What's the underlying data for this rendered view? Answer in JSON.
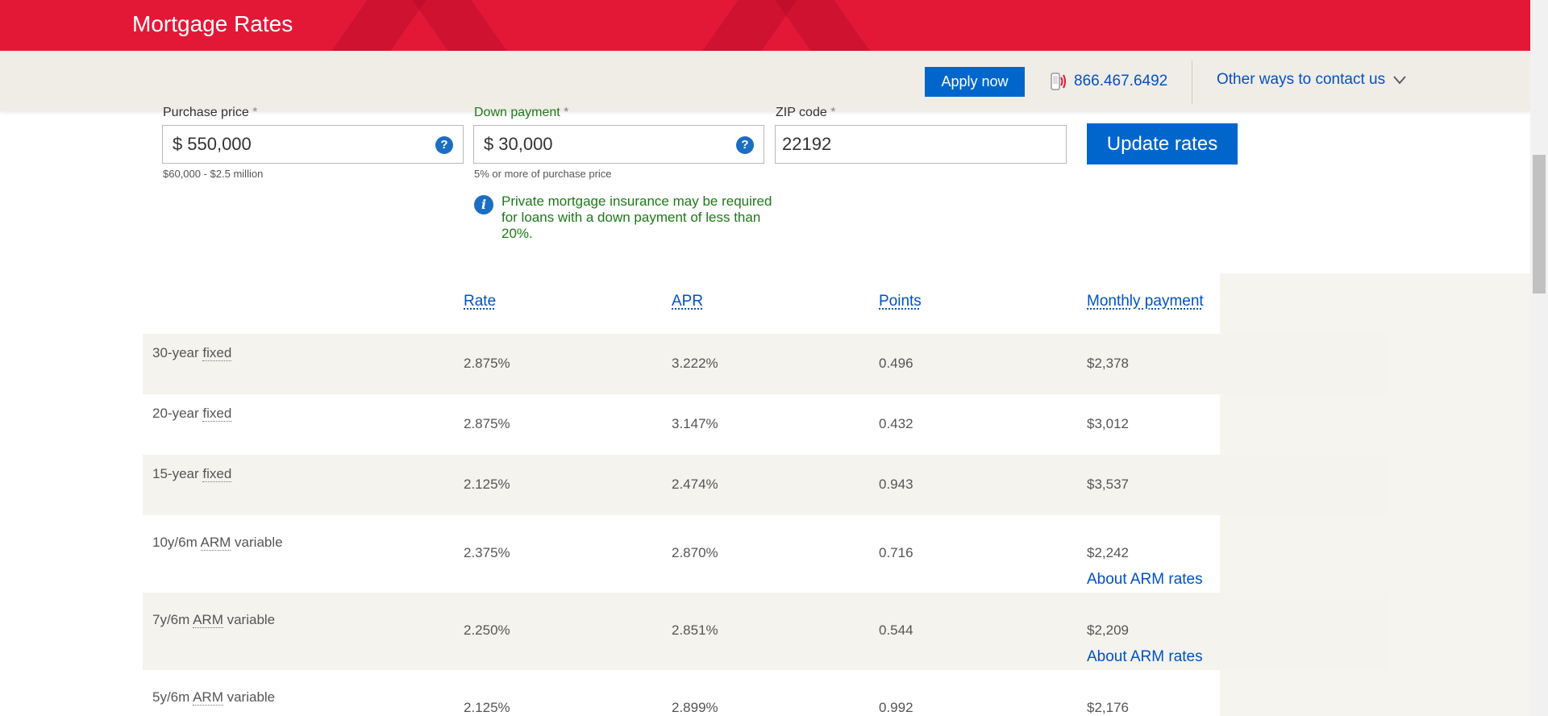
{
  "banner": {
    "title": "Mortgage Rates"
  },
  "contact_bar": {
    "apply_label": "Apply now",
    "phone": "866.467.6492",
    "other_ways": "Other ways to contact us"
  },
  "form": {
    "purchase_price": {
      "label": "Purchase price",
      "required_mark": "*",
      "prefix": "$",
      "value": "550,000",
      "hint": "$60,000 - $2.5 million"
    },
    "down_payment": {
      "label": "Down payment",
      "required_mark": "*",
      "prefix": "$",
      "value": "30,000",
      "hint": "5% or more of purchase price"
    },
    "zip": {
      "label": "ZIP code",
      "required_mark": "*",
      "value": "22192"
    },
    "update_label": "Update rates",
    "pmi_note": "Private mortgage insurance may be required for loans with a down payment of less than 20%."
  },
  "table": {
    "headers": {
      "rate": "Rate",
      "apr": "APR",
      "points": "Points",
      "monthly": "Monthly payment"
    },
    "arm_link": "About ARM rates",
    "rows": [
      {
        "prefix": "30-year ",
        "abbr": "fixed",
        "suffix": "",
        "rate": "2.875%",
        "apr": "3.222%",
        "points": "0.496",
        "monthly": "$2,378"
      },
      {
        "prefix": "20-year ",
        "abbr": "fixed",
        "suffix": "",
        "rate": "2.875%",
        "apr": "3.147%",
        "points": "0.432",
        "monthly": "$3,012"
      },
      {
        "prefix": "15-year ",
        "abbr": "fixed",
        "suffix": "",
        "rate": "2.125%",
        "apr": "2.474%",
        "points": "0.943",
        "monthly": "$3,537"
      },
      {
        "prefix": "10y/6m ",
        "abbr": "ARM",
        "suffix": " variable",
        "rate": "2.375%",
        "apr": "2.870%",
        "points": "0.716",
        "monthly": "$2,242"
      },
      {
        "prefix": "7y/6m ",
        "abbr": "ARM",
        "suffix": " variable",
        "rate": "2.250%",
        "apr": "2.851%",
        "points": "0.544",
        "monthly": "$2,209"
      },
      {
        "prefix": "5y/6m ",
        "abbr": "ARM",
        "suffix": " variable",
        "rate": "2.125%",
        "apr": "2.899%",
        "points": "0.992",
        "monthly": "$2,176"
      }
    ]
  },
  "colors": {
    "brand_red": "#e31837",
    "link_blue": "#0052c2",
    "button_blue": "#0066cc",
    "note_green": "#1b7a17"
  }
}
